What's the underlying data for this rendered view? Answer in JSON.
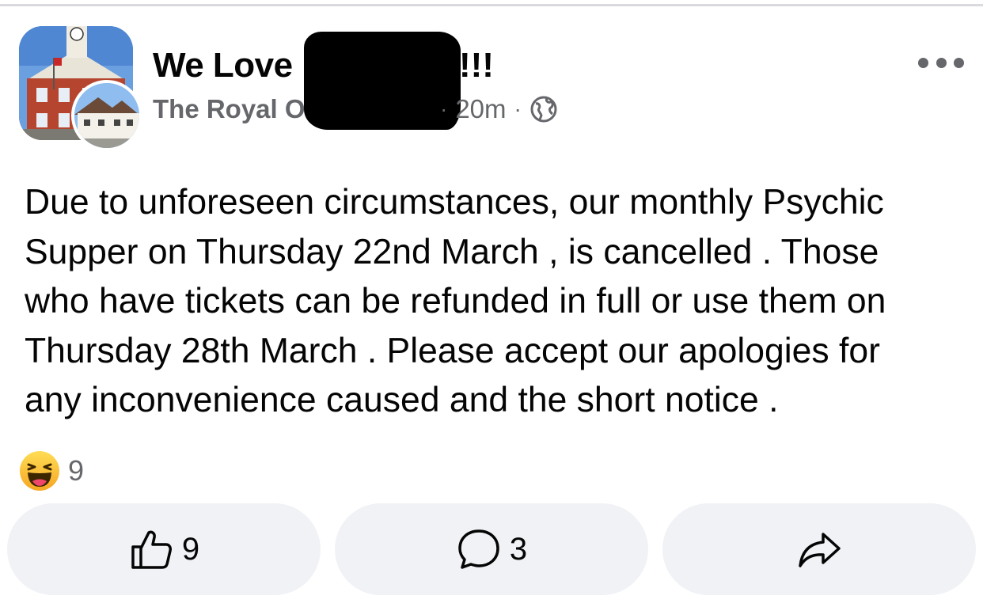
{
  "post": {
    "group_name": "We Love",
    "group_name_tail": "!!!",
    "author": "The Royal Oak",
    "time": "20m",
    "separator": "·",
    "privacy_icon": "globe-icon",
    "more_icon": "more-horizontal-icon",
    "body": "Due to unforeseen circumstances, our monthly Psychic\nSupper on Thursday 22nd March , is cancelled . Those\nwho have tickets can be refunded in full or use them on\nThursday 28th March . Please accept our apologies for\nany inconvenience caused and the short notice ."
  },
  "reactions": {
    "icon": "haha-reaction-icon",
    "count": "9"
  },
  "actions": {
    "like": {
      "icon": "thumbs-up-icon",
      "count": "9"
    },
    "comment": {
      "icon": "comment-icon",
      "count": "3"
    },
    "share": {
      "icon": "share-icon"
    }
  },
  "colors": {
    "text": "#050505",
    "secondary_text": "#65676b",
    "button_bg": "#f0f2f5",
    "divider": "#d9dadd"
  }
}
